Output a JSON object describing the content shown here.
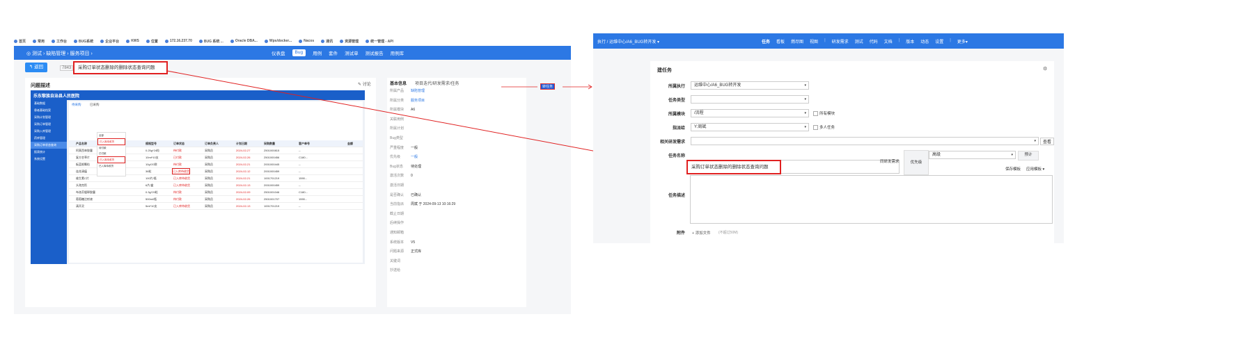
{
  "left": {
    "bookmarks": [
      "首页",
      "常用",
      "工作台",
      "BUG系统",
      "企业平台",
      "KWS",
      "位置",
      "172.16.237.70",
      "BUG 系统 ...",
      "Oracle DBA...",
      "Wps/docker...",
      "Nacos",
      "通讯",
      "资源管理",
      "统一管理 - API"
    ],
    "nav": {
      "breadcrumb": "◎ 测试 › 缺陷管理 › 服务项目 ›",
      "tabs": [
        "仪表盘",
        "Bug",
        "用例",
        "套件",
        "测试单",
        "测试报告",
        "用例库"
      ],
      "active_tab": "Bug"
    },
    "back_label": "↰ 返回",
    "bug_id": "7843",
    "bug_title": "采购订单状态删除的删除状态查询问题",
    "description_heading": "问题描述",
    "mini": {
      "logo": "乐东黎族自治县人民医院",
      "side_items": [
        "基础数据",
        "患者基础档案",
        "采购计划管理",
        "采购订单管理",
        "采购入库管理",
        "药库管理",
        "采购订单状态查询",
        "报表统计",
        "系统设置"
      ],
      "filter_tabs": [
        "待采购",
        "已采购"
      ],
      "columns": [
        "产品名称",
        "规格型号",
        "订单状态",
        "订单负责人",
        "计划日期",
        "采购数量",
        "客户单号",
        "金额"
      ],
      "rows": [
        [
          "阿莫西林胶囊",
          "0.25g*24粒",
          "待付款",
          "采购员",
          "2024-02-27",
          "2501000815",
          "--"
        ],
        [
          "复方甘草片",
          "10ml*10支",
          "已付款",
          "采购员",
          "2024-02-26",
          "2501000456",
          "C180..."
        ],
        [
          "板蓝根颗粒",
          "10g*20袋",
          "待付款",
          "采购员",
          "2024-02-21",
          "2001000445",
          "--"
        ],
        [
          "连花清瘟",
          "36粒",
          "已入库待收货",
          "采购员",
          "2024-02-12",
          "2001000459",
          "--"
        ],
        [
          "维生素C片",
          "100片/瓶",
          "已入库待收货",
          "采购员",
          "2024-02-21",
          "1001701219",
          "1590..."
        ],
        [
          "头孢克肟",
          "6片/盒",
          "已入库待收货",
          "采购员",
          "2024-02-13",
          "2001000459",
          "--"
        ],
        [
          "布洛芬缓释胶囊",
          "0.3g*20粒",
          "待付款",
          "采购员",
          "2024-02-09",
          "2501001046",
          "C180..."
        ],
        [
          "葡萄糖注射液",
          "500ml/瓶",
          "待付款",
          "采购员",
          "2024-02-26",
          "2501001707",
          "1590..."
        ],
        [
          "清开灵",
          "5ml*10支",
          "已入库待收货",
          "采购员",
          "2024-02-13",
          "1001701219",
          "--"
        ]
      ],
      "dropdown": [
        "全部",
        "已入库待收货",
        "待付款",
        "已付款",
        "已入库待收货",
        "已入库待收货"
      ]
    },
    "info_tabs": [
      "基本信息",
      "项目迭代/研发需求/任务"
    ],
    "info": [
      {
        "k": "所属产品",
        "v": "缺陷管理",
        "link": true
      },
      {
        "k": "所属分类",
        "v": "服务项目",
        "link": true
      },
      {
        "k": "所属模块",
        "v": "A6",
        "link": false
      },
      {
        "k": "关联用例",
        "v": "",
        "link": false
      },
      {
        "k": "所属计划",
        "v": "",
        "link": false
      },
      {
        "k": "Bug类型",
        "v": "",
        "link": false
      },
      {
        "k": "严重程度",
        "v": "一般",
        "link": false
      },
      {
        "k": "优先级",
        "v": "一般",
        "link": true
      },
      {
        "k": "Bug状态",
        "v": "待处理",
        "link": false
      },
      {
        "k": "激活次数",
        "v": "0",
        "link": false
      },
      {
        "k": "激活日期",
        "v": "",
        "link": false
      },
      {
        "k": "是否确认",
        "v": "已确认",
        "link": false
      },
      {
        "k": "当前指派",
        "v": "周斌 于 2024-09-13 10:16:29",
        "link": false
      },
      {
        "k": "截止日期",
        "v": "",
        "link": false
      },
      {
        "k": "后续操作",
        "v": "",
        "link": false
      },
      {
        "k": "通知邮箱",
        "v": "",
        "link": false
      },
      {
        "k": "系统版本",
        "v": "V5",
        "link": false
      },
      {
        "k": "问题来源",
        "v": "正式库",
        "link": false
      },
      {
        "k": "关键词",
        "v": "",
        "link": false
      },
      {
        "k": "抄送给",
        "v": "",
        "link": false
      }
    ],
    "side_link": "讨论"
  },
  "middle_tag": "转任务",
  "right": {
    "nav": {
      "breadcrumb": "执行 / 运维中心/A6_BUG转开发 ▾",
      "tabs": [
        "任务",
        "看板",
        "燃尽图",
        "视图",
        "研发需求",
        "测试",
        "代码",
        "文档",
        "版本",
        "动态",
        "设置",
        "更多▾"
      ]
    },
    "form_title": "建任务",
    "fields": {
      "execution_label": "所属执行",
      "execution_value": "运维中心/A6_BUG转开发",
      "type_label": "任务类型",
      "type_value": "",
      "module_label": "所属模块",
      "module_value": "/流程",
      "module_check": "所有模块",
      "assign_label": "指派给",
      "assign_value": "Y:周斌",
      "assign_check": "多人任务",
      "story_label": "相关研发需求",
      "story_value": "",
      "story_btn": "查看",
      "name_label": "任务名称",
      "name_value": "采购订单状态删除的删除状态查询问题",
      "similar_label": "同研发需求",
      "priority_label": "优先级",
      "priority_value": "高级",
      "estimate_label": "预计",
      "save_template": "保存模板",
      "apply_template": "应用模板 ▾",
      "desc_label": "任务描述",
      "attach_label": "附件",
      "attach_btn": "+ 添加文件",
      "attach_hint": "(不超过50M)"
    }
  }
}
